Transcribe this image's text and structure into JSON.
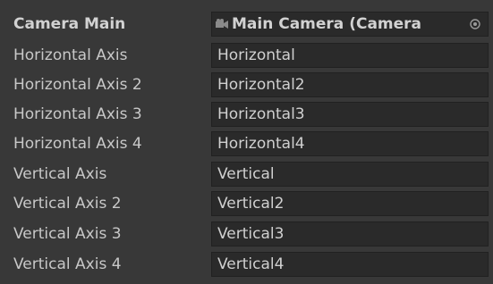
{
  "camera": {
    "label": "Camera Main",
    "value": "Main Camera (Camera",
    "icon": "camera-icon",
    "picker_icon": "object-picker-icon"
  },
  "axes": [
    {
      "label": "Horizontal Axis",
      "value": "Horizontal"
    },
    {
      "label": "Horizontal Axis 2",
      "value": "Horizontal2"
    },
    {
      "label": "Horizontal Axis 3",
      "value": "Horizontal3"
    },
    {
      "label": "Horizontal Axis 4",
      "value": "Horizontal4"
    },
    {
      "label": "Vertical Axis",
      "value": "Vertical"
    },
    {
      "label": "Vertical Axis 2",
      "value": "Vertical2"
    },
    {
      "label": "Vertical Axis 3",
      "value": "Vertical3"
    },
    {
      "label": "Vertical Axis 4",
      "value": "Vertical4"
    }
  ],
  "colors": {
    "panel": "#383838",
    "field": "#2a2a2a",
    "text": "#c8c8c8"
  }
}
